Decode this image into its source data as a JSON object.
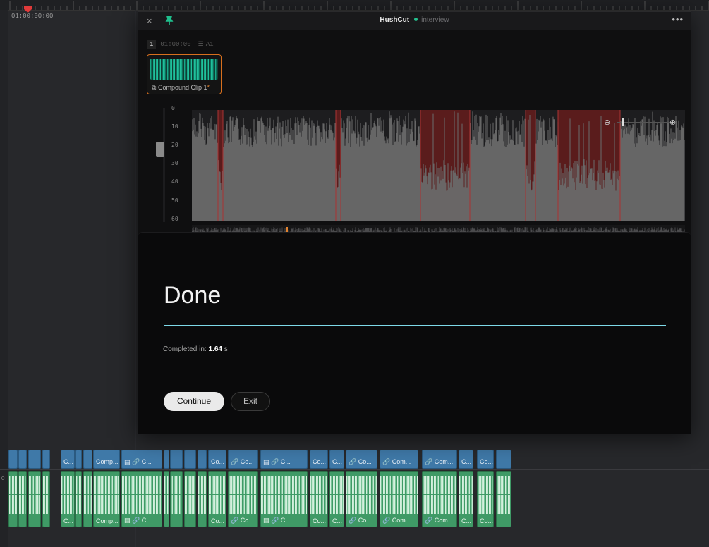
{
  "timeline": {
    "timecode": "01:00:00:00",
    "track_label": "0",
    "video_clips": [
      {
        "label": ""
      },
      {
        "label": ""
      },
      {
        "label": ""
      },
      {
        "label": ""
      },
      {
        "label": "C..."
      },
      {
        "label": ""
      },
      {
        "label": ""
      },
      {
        "label": "Comp..."
      },
      {
        "label": "▤ 🔗 C..."
      },
      {
        "label": ""
      },
      {
        "label": ""
      },
      {
        "label": ""
      },
      {
        "label": ""
      },
      {
        "label": "Co..."
      },
      {
        "label": "🔗 Co..."
      },
      {
        "label": "▤ 🔗 C..."
      },
      {
        "label": "Co..."
      },
      {
        "label": "C..."
      },
      {
        "label": "🔗 Co..."
      },
      {
        "label": "🔗 Com..."
      },
      {
        "label": "🔗 Com..."
      },
      {
        "label": "C..."
      },
      {
        "label": "Co..."
      },
      {
        "label": ""
      }
    ],
    "audio_clips": [
      {
        "label": ""
      },
      {
        "label": ""
      },
      {
        "label": ""
      },
      {
        "label": ""
      },
      {
        "label": "C..."
      },
      {
        "label": ""
      },
      {
        "label": ""
      },
      {
        "label": "Comp..."
      },
      {
        "label": "▤ 🔗 C..."
      },
      {
        "label": ""
      },
      {
        "label": ""
      },
      {
        "label": ""
      },
      {
        "label": ""
      },
      {
        "label": "Co..."
      },
      {
        "label": "🔗 Co..."
      },
      {
        "label": "▤ 🔗 C..."
      },
      {
        "label": "Co..."
      },
      {
        "label": "C..."
      },
      {
        "label": "🔗 Co..."
      },
      {
        "label": "🔗 Com..."
      },
      {
        "label": "🔗 Com..."
      },
      {
        "label": "C..."
      },
      {
        "label": "Co..."
      },
      {
        "label": ""
      }
    ]
  },
  "hushcut": {
    "close_icon": "×",
    "pin_icon": "pin-icon",
    "app_title": "HushCut",
    "project_name": "interview",
    "menu_icon": "•••",
    "clip": {
      "number": "1",
      "timecode": "01:00:00",
      "track_icon": "☰",
      "track": "A1",
      "name": "Compound Clip 1",
      "modified_marker": "*",
      "stack_icon": "⧉"
    },
    "meter_ticks": [
      "0",
      "10",
      "20",
      "30",
      "40",
      "50",
      "60"
    ],
    "zoom_out_icon": "⊖",
    "zoom_in_icon": "⊕",
    "silence_color": "#5a1c1c",
    "audio_color": "#6a6a6a",
    "progress_color": "#7ed9e8",
    "done": {
      "heading": "Done",
      "progress": 1.0,
      "completed_label": "Completed in: ",
      "completed_value": "1.64",
      "completed_unit": " s",
      "continue_label": "Continue",
      "exit_label": "Exit"
    }
  }
}
